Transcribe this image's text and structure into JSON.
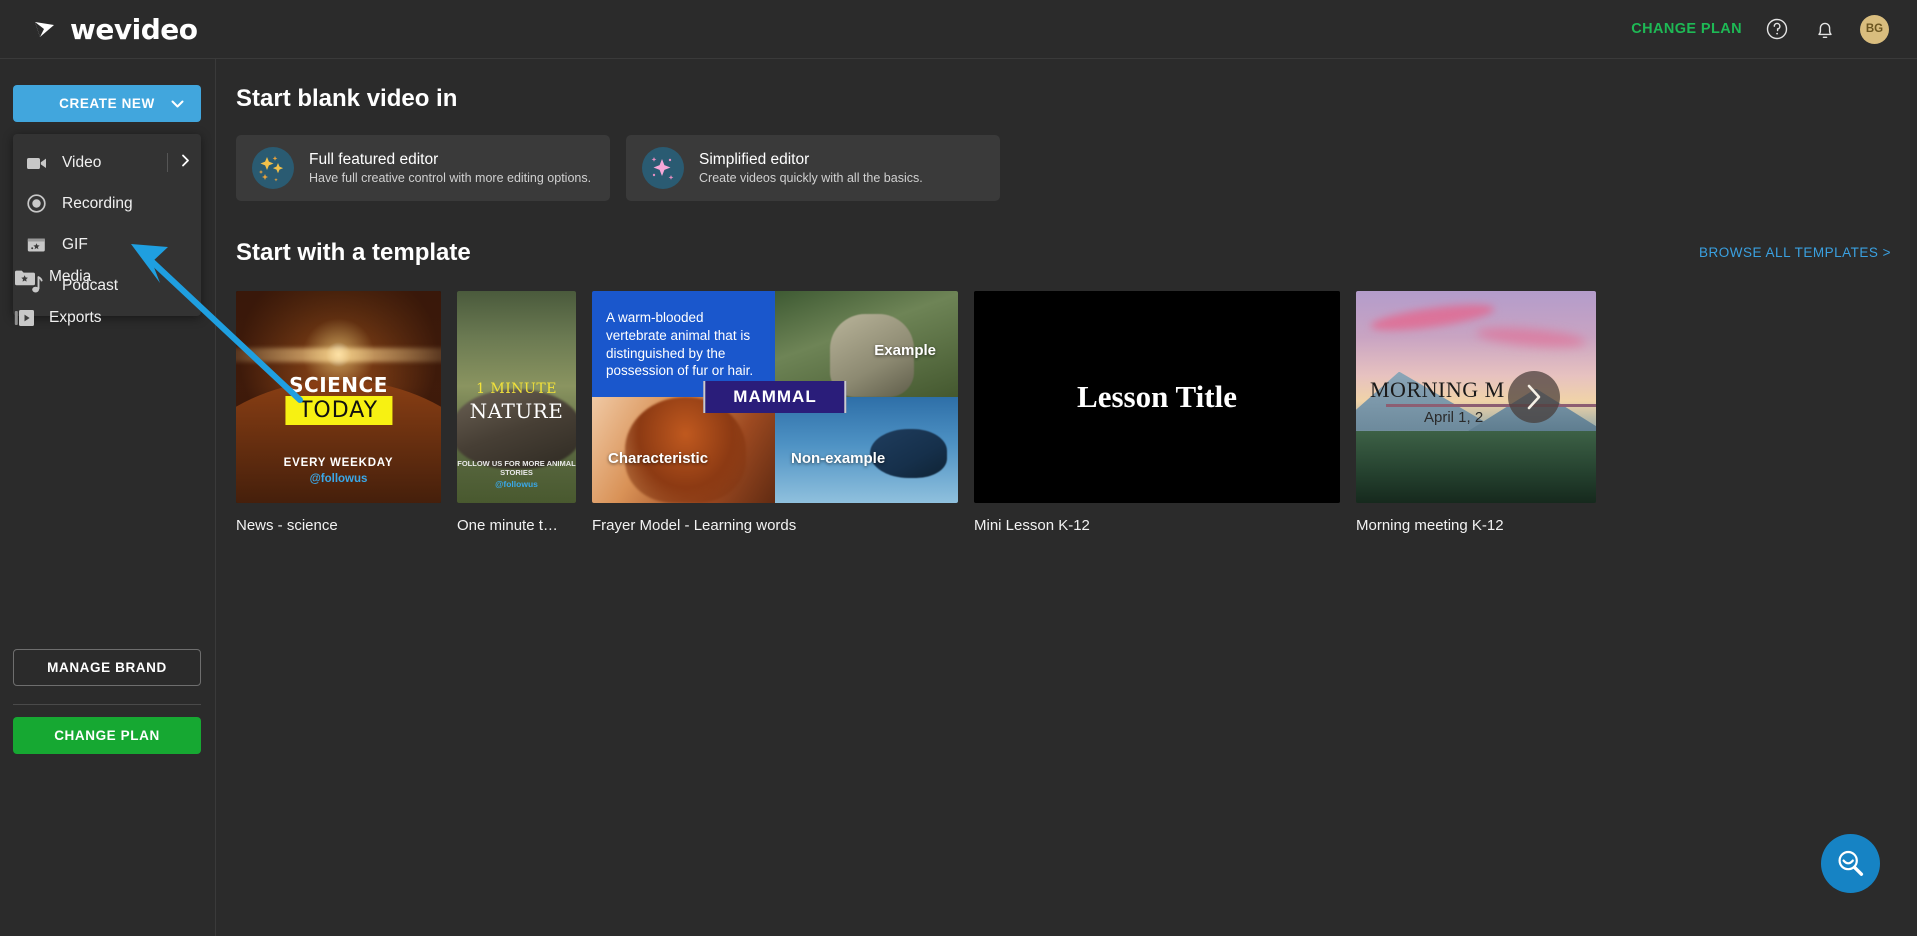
{
  "header": {
    "logo_text": "wevideo",
    "logo_icon": "wevideo-play-mark",
    "change_plan_label": "CHANGE PLAN",
    "help_icon": "help-circle-icon",
    "notifications_icon": "bell-icon",
    "avatar_initials": "BG",
    "accent_green": "#1eb955"
  },
  "sidebar": {
    "create_new_label": "CREATE NEW",
    "create_new_chevron": "chevron-down-icon",
    "dropdown": {
      "items": [
        {
          "label": "Video",
          "icon": "video-camera-icon",
          "has_submenu": true,
          "submenu_icon": "chevron-right-icon"
        },
        {
          "label": "Recording",
          "icon": "record-circle-icon",
          "has_submenu": false
        },
        {
          "label": "GIF",
          "icon": "gif-clapper-icon",
          "has_submenu": false
        },
        {
          "label": "Podcast",
          "icon": "music-note-icon",
          "has_submenu": false
        }
      ]
    },
    "nav": [
      {
        "label": "Media",
        "icon": "folder-star-icon"
      },
      {
        "label": "Exports",
        "icon": "export-play-icon"
      }
    ],
    "manage_brand_label": "MANAGE BRAND",
    "change_plan_label": "CHANGE PLAN",
    "change_plan_color": "#16a832",
    "create_new_color": "#41a6dd"
  },
  "main": {
    "blank_video_heading": "Start blank video in",
    "editors": [
      {
        "title": "Full featured editor",
        "subtitle": "Have full creative control with more editing options.",
        "icon": "sparkles-icon",
        "icon_color": "#f2c14a"
      },
      {
        "title": "Simplified editor",
        "subtitle": "Create videos quickly with all the basics.",
        "icon": "sparkle-icon",
        "icon_color": "#f6a8d8"
      }
    ],
    "template_heading": "Start with a template",
    "browse_all_label": "BROWSE ALL TEMPLATES >",
    "browse_all_color": "#3aa0e0",
    "templates": [
      {
        "caption": "News - science",
        "thumb": {
          "line1": "SCIENCE",
          "line2": "TODAY",
          "line3": "EVERY WEEKDAY",
          "handle": "@followus"
        }
      },
      {
        "caption": "One minute t…",
        "thumb": {
          "line1": "1 MINUTE",
          "line2": "NATURE",
          "line3": "FOLLOW US FOR MORE ANIMAL STORIES",
          "handle": "@followus"
        }
      },
      {
        "caption": "Frayer Model - Learning words",
        "thumb": {
          "definition": "A warm-blooded vertebrate animal that is distinguished by the possession of fur or hair.",
          "banner": "MAMMAL",
          "example": "Example",
          "characteristic": "Characteristic",
          "non_example": "Non-example"
        }
      },
      {
        "caption": "Mini Lesson K-12",
        "thumb": {
          "title": "Lesson Title"
        }
      },
      {
        "caption": "Morning meeting K-12",
        "thumb": {
          "title": "MORNING M",
          "date": "April 1, 2"
        }
      }
    ],
    "carousel_next_icon": "chevron-right-icon"
  },
  "fab": {
    "icon": "search-smile-icon",
    "color": "#1683c4"
  },
  "annotation": {
    "type": "arrow",
    "color": "#1f9fe0",
    "points_to": "GIF"
  }
}
